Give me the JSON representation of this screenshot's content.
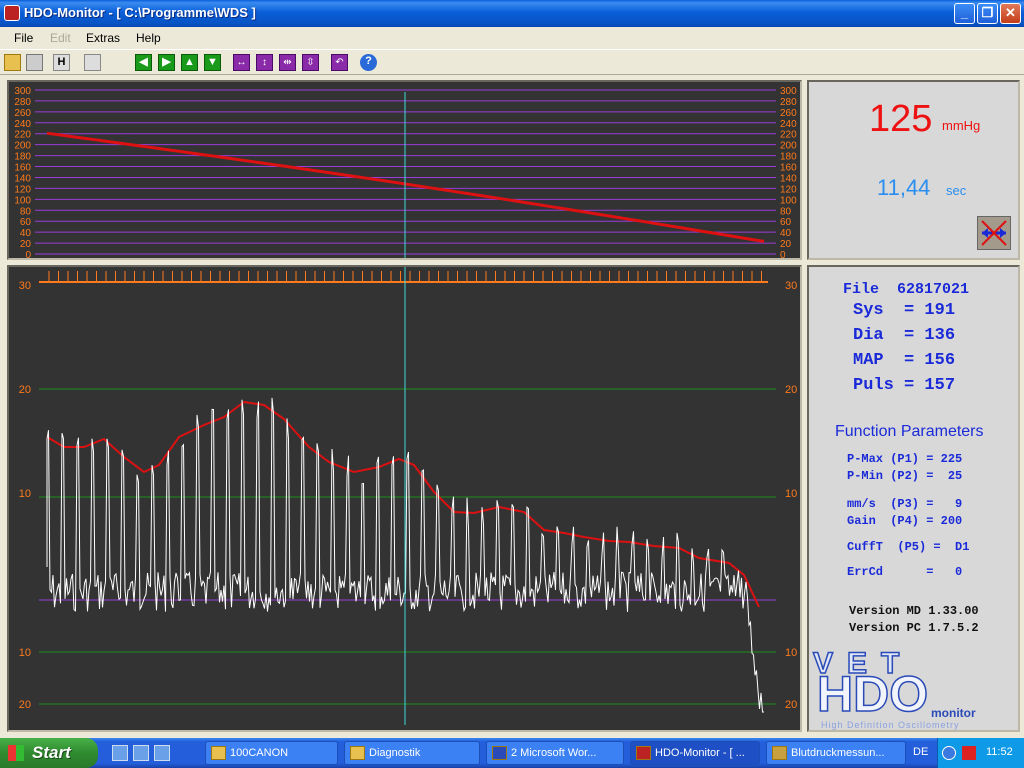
{
  "window": {
    "title": "HDO-Monitor - [ C:\\Programme\\WDS ]",
    "minimize": "_",
    "restore": "❐",
    "close": "✕"
  },
  "menu": {
    "file": "File",
    "edit": "Edit",
    "extras": "Extras",
    "help": "Help"
  },
  "toolbar": {
    "h_label": "H",
    "help_label": "?"
  },
  "pressure_chart": {
    "y_ticks": [
      "300",
      "280",
      "260",
      "240",
      "220",
      "200",
      "180",
      "160",
      "140",
      "120",
      "100",
      "80",
      "60",
      "40",
      "20",
      "0"
    ],
    "cursor_value": 120
  },
  "oscillation_chart": {
    "left_labels": [
      "30",
      "20",
      "10",
      "10",
      "20"
    ],
    "right_labels": [
      "30",
      "20",
      "10",
      "10",
      "20"
    ]
  },
  "live": {
    "pressure_value": "125",
    "pressure_unit": "mmHg",
    "time_value": "11,44",
    "time_unit": "sec"
  },
  "results": {
    "file": "File  62817021",
    "sys": "Sys  = 191",
    "dia": "Dia  = 136",
    "map": "MAP  = 156",
    "puls": "Puls = 157"
  },
  "function_parameters": {
    "title": "Function Parameters",
    "pmax": "P-Max (P1) = 225",
    "pmin": "P-Min (P2) =  25",
    "speed": "mm/s  (P3) =   9",
    "gain": "Gain  (P4) = 200",
    "cufft": "CuffT  (P5) =  D1",
    "errcd": "ErrCd      =   0"
  },
  "versions": {
    "md": "Version MD 1.33.00",
    "pc": "Version PC 1.7.5.2"
  },
  "logo": {
    "vet": "VET",
    "hdo": "HDO",
    "monitor": "monitor",
    "tagline": "High Definition Oscillometry"
  },
  "taskbar": {
    "start": "Start",
    "tasks": [
      "100CANON",
      "Diagnostik",
      "2 Microsoft Wor...",
      "HDO-Monitor - [ ...",
      "Blutdruckmessun..."
    ],
    "lang": "DE",
    "clock": "11:52"
  },
  "colors": {
    "chart_bg": "#333333",
    "grid_purple": "#9a3cd8",
    "grid_green": "#1e8f1e",
    "tick_orange": "#ff7a1a",
    "curve_red": "#dd1111",
    "cursor_cyan": "#40d8d8",
    "value_red": "#ee1111",
    "value_blue": "#2a8ef0",
    "text_blue": "#1a2ad8"
  }
}
